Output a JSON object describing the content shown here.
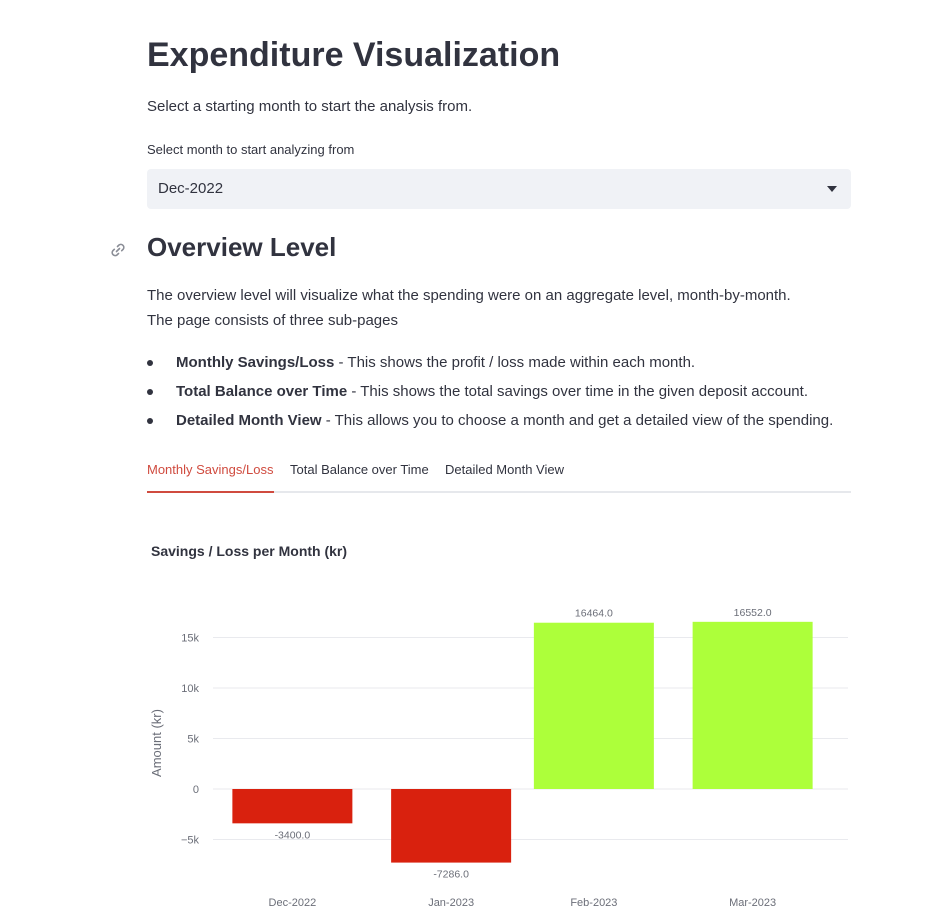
{
  "header": {
    "title": "Expenditure Visualization",
    "subtitle": "Select a starting month to start the analysis from."
  },
  "month_select": {
    "label": "Select month to start analyzing from",
    "value": "Dec-2022"
  },
  "overview": {
    "heading": "Overview Level",
    "para1": "The overview level will visualize what the spending were on an aggregate level, month-by-month.",
    "para2": "The page consists of three sub-pages",
    "bullets": [
      {
        "bold": "Monthly Savings/Loss",
        "text": " - This shows the profit / loss made within each month."
      },
      {
        "bold": "Total Balance over Time",
        "text": " - This shows the total savings over time in the given deposit account."
      },
      {
        "bold": "Detailed Month View",
        "text": " - This allows you to choose a month and get a detailed view of the spending."
      }
    ]
  },
  "tabs": [
    {
      "label": "Monthly Savings/Loss",
      "active": true
    },
    {
      "label": "Total Balance over Time",
      "active": false
    },
    {
      "label": "Detailed Month View",
      "active": false
    }
  ],
  "colors": {
    "accent": "#d04b3f",
    "positive": "#adff3a",
    "negative": "#d9210e"
  },
  "chart_data": {
    "type": "bar",
    "title": "Savings / Loss per Month (kr)",
    "xlabel": "",
    "ylabel": "Amount (kr)",
    "categories": [
      "Dec-2022",
      "Jan-2023",
      "Feb-2023",
      "Mar-2023"
    ],
    "values": [
      -3400.0,
      -7286.0,
      16464.0,
      16552.0
    ],
    "data_labels": [
      "-3400.0",
      "-7286.0",
      "16464.0",
      "16552.0"
    ],
    "yticks": [
      -5000,
      0,
      5000,
      10000,
      15000
    ],
    "ytick_labels": [
      "−5k",
      "0",
      "5k",
      "10k",
      "15k"
    ],
    "grid": true,
    "legend": "none"
  }
}
